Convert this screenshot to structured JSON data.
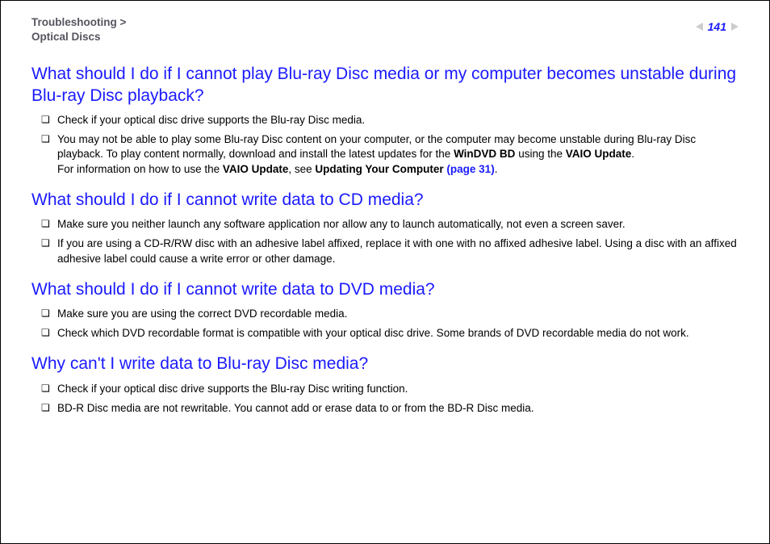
{
  "breadcrumb": {
    "line1": "Troubleshooting >",
    "line2": "Optical Discs"
  },
  "page_number": "141",
  "sections": [
    {
      "heading": "What should I do if I cannot play Blu-ray Disc media or my computer becomes unstable during Blu-ray Disc playback?",
      "items": [
        {
          "p1": "Check if your optical disc drive supports the Blu-ray Disc media."
        },
        {
          "p1a": "You may not be able to play some Blu-ray Disc content on your computer, or the computer may become unstable during Blu-ray Disc playback. To play content normally, download and install the latest updates for the ",
          "b1": "WinDVD BD",
          "p1b": " using the ",
          "b2": "VAIO Update",
          "p1c": ".",
          "p2a": "For information on how to use the ",
          "b3": "VAIO Update",
          "p2b": ", see ",
          "b4": "Updating Your Computer ",
          "link": "(page 31)",
          "p2c": "."
        }
      ]
    },
    {
      "heading": "What should I do if I cannot write data to CD media?",
      "items": [
        {
          "p1": "Make sure you neither launch any software application nor allow any to launch automatically, not even a screen saver."
        },
        {
          "p1": "If you are using a CD-R/RW disc with an adhesive label affixed, replace it with one with no affixed adhesive label. Using a disc with an affixed adhesive label could cause a write error or other damage."
        }
      ]
    },
    {
      "heading": "What should I do if I cannot write data to DVD media?",
      "items": [
        {
          "p1": "Make sure you are using the correct DVD recordable media."
        },
        {
          "p1": "Check which DVD recordable format is compatible with your optical disc drive. Some brands of DVD recordable media do not work."
        }
      ]
    },
    {
      "heading": "Why can't I write data to Blu-ray Disc media?",
      "items": [
        {
          "p1": "Check if your optical disc drive supports the Blu-ray Disc writing function."
        },
        {
          "p1": "BD-R Disc media are not rewritable. You cannot add or erase data to or from the BD-R Disc media."
        }
      ]
    }
  ]
}
